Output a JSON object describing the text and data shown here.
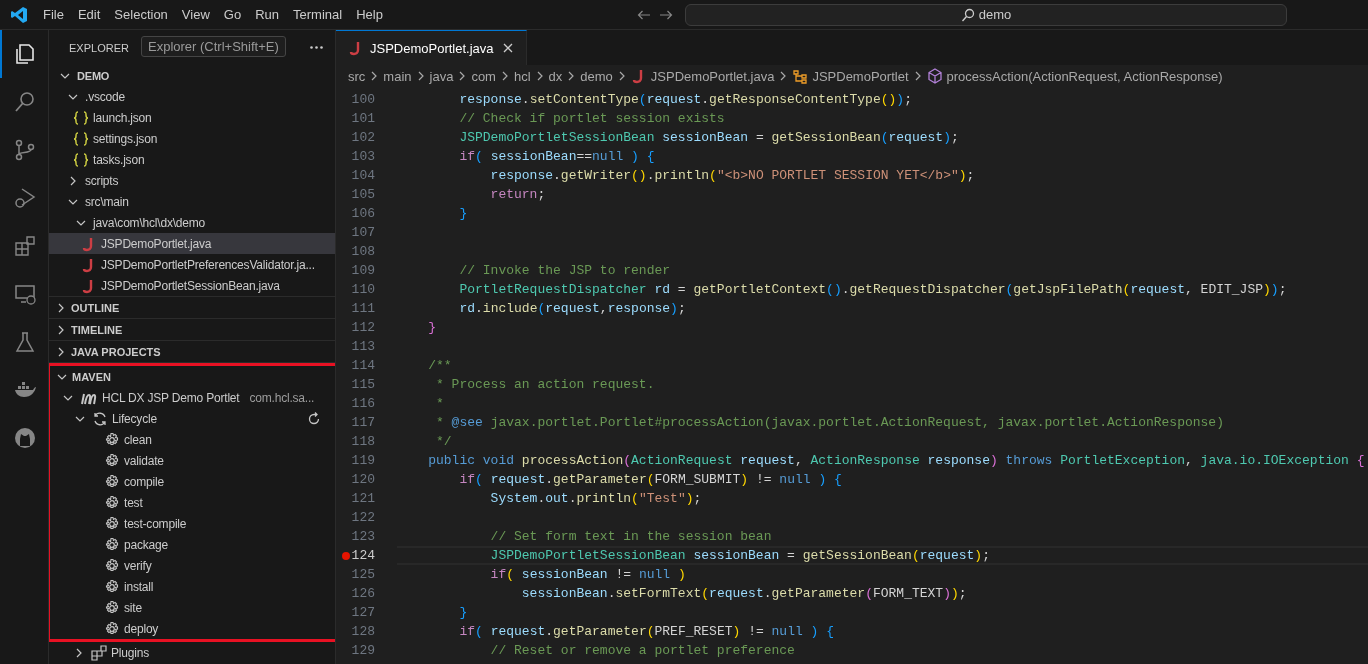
{
  "title_bar": {
    "menus": [
      "File",
      "Edit",
      "Selection",
      "View",
      "Go",
      "Run",
      "Terminal",
      "Help"
    ],
    "command_center": "demo"
  },
  "activity_bar": {
    "items": [
      {
        "selected": true
      },
      {
        "selected": false
      },
      {
        "selected": false
      },
      {
        "selected": false
      },
      {
        "selected": false
      },
      {
        "selected": false
      },
      {
        "selected": false
      },
      {
        "selected": false
      },
      {
        "selected": false
      }
    ]
  },
  "explorer": {
    "title": "EXPLORER",
    "tooltip": "Explorer (Ctrl+Shift+E)",
    "tree": [
      {
        "label": "DEMO",
        "kind": "root",
        "expanded": true,
        "children": [
          {
            "label": ".vscode",
            "kind": "folder",
            "expanded": true,
            "children": [
              {
                "label": "launch.json",
                "kind": "json",
                "selected": false
              },
              {
                "label": "settings.json",
                "kind": "json",
                "selected": false
              },
              {
                "label": "tasks.json",
                "kind": "json",
                "selected": false
              }
            ]
          },
          {
            "label": "scripts",
            "kind": "folder",
            "expanded": false
          },
          {
            "label": "src\\main",
            "kind": "folder",
            "expanded": true,
            "children": [
              {
                "label": "java\\com\\hcl\\dx\\demo",
                "kind": "folder",
                "expanded": true,
                "children": [
                  {
                    "label": "JSPDemoPortlet.java",
                    "kind": "java",
                    "selected": true
                  },
                  {
                    "label": "JSPDemoPortletPreferencesValidator.ja...",
                    "kind": "java",
                    "selected": false
                  },
                  {
                    "label": "JSPDemoPortletSessionBean.java",
                    "kind": "java",
                    "selected": false
                  }
                ]
              }
            ]
          }
        ]
      }
    ]
  },
  "sections": [
    {
      "title": "OUTLINE",
      "expanded": false,
      "highlighted": false
    },
    {
      "title": "TIMELINE",
      "expanded": false,
      "highlighted": false
    },
    {
      "title": "JAVA PROJECTS",
      "expanded": false,
      "highlighted": false
    },
    {
      "title": "MAVEN",
      "expanded": true,
      "highlighted": true,
      "tree": [
        {
          "label": "HCL DX JSP Demo Portlet",
          "description": "com.hcl.sa...",
          "kind": "project",
          "expanded": true,
          "children": [
            {
              "label": "Lifecycle",
              "kind": "lifecycle",
              "expanded": true,
              "children": [
                {
                  "label": "clean",
                  "kind": "goal"
                },
                {
                  "label": "validate",
                  "kind": "goal"
                },
                {
                  "label": "compile",
                  "kind": "goal"
                },
                {
                  "label": "test",
                  "kind": "goal"
                },
                {
                  "label": "test-compile",
                  "kind": "goal"
                },
                {
                  "label": "package",
                  "kind": "goal"
                },
                {
                  "label": "verify",
                  "kind": "goal"
                },
                {
                  "label": "install",
                  "kind": "goal"
                },
                {
                  "label": "site",
                  "kind": "goal"
                },
                {
                  "label": "deploy",
                  "kind": "goal"
                }
              ]
            },
            {
              "label": "Plugins",
              "kind": "plugins",
              "expanded": false
            }
          ]
        }
      ]
    }
  ],
  "editor": {
    "tabs": [
      {
        "label": "JSPDemoPortlet.java",
        "selected": true
      }
    ],
    "breadcrumb": [
      {
        "label": "src",
        "kind": "folder"
      },
      {
        "label": "main",
        "kind": "folder"
      },
      {
        "label": "java",
        "kind": "folder"
      },
      {
        "label": "com",
        "kind": "folder"
      },
      {
        "label": "hcl",
        "kind": "folder"
      },
      {
        "label": "dx",
        "kind": "folder"
      },
      {
        "label": "demo",
        "kind": "folder"
      },
      {
        "label": "JSPDemoPortlet.java",
        "kind": "java"
      },
      {
        "label": "JSPDemoPortlet",
        "kind": "class"
      },
      {
        "label": "processAction(ActionRequest, ActionResponse)",
        "kind": "method"
      }
    ],
    "lines": [
      {
        "number": "100",
        "active": false,
        "breakpoint": false,
        "tokens": [
          {
            "text": "        response",
            "kind": "var"
          },
          {
            "text": ".",
            "kind": "pl"
          },
          {
            "text": "setContentType",
            "kind": "fn"
          },
          {
            "text": "(",
            "kind": "b3"
          },
          {
            "text": "request",
            "kind": "var"
          },
          {
            "text": ".",
            "kind": "pl"
          },
          {
            "text": "getResponseContentType",
            "kind": "fn"
          },
          {
            "text": "()",
            "kind": "b1"
          },
          {
            "text": ")",
            "kind": "b3"
          },
          {
            "text": ";",
            "kind": "pl"
          }
        ]
      },
      {
        "number": "101",
        "active": false,
        "breakpoint": false,
        "tokens": [
          {
            "text": "        // Check if portlet session exists",
            "kind": "com"
          }
        ]
      },
      {
        "number": "102",
        "active": false,
        "breakpoint": false,
        "tokens": [
          {
            "text": "        JSPDemoPortletSessionBean",
            "kind": "type"
          },
          {
            "text": " sessionBean",
            "kind": "var"
          },
          {
            "text": " = ",
            "kind": "pl"
          },
          {
            "text": "getSessionBean",
            "kind": "fn"
          },
          {
            "text": "(",
            "kind": "b3"
          },
          {
            "text": "request",
            "kind": "var"
          },
          {
            "text": ")",
            "kind": "b3"
          },
          {
            "text": ";",
            "kind": "pl"
          }
        ]
      },
      {
        "number": "103",
        "active": false,
        "breakpoint": false,
        "tokens": [
          {
            "text": "        if",
            "kind": "ctl"
          },
          {
            "text": "(",
            "kind": "b3"
          },
          {
            "text": " sessionBean",
            "kind": "var"
          },
          {
            "text": "==",
            "kind": "pl"
          },
          {
            "text": "null",
            "kind": "kw"
          },
          {
            "text": " )",
            "kind": "b3"
          },
          {
            "text": " {",
            "kind": "b3"
          }
        ]
      },
      {
        "number": "104",
        "active": false,
        "breakpoint": false,
        "tokens": [
          {
            "text": "            response",
            "kind": "var"
          },
          {
            "text": ".",
            "kind": "pl"
          },
          {
            "text": "getWriter",
            "kind": "fn"
          },
          {
            "text": "()",
            "kind": "b1"
          },
          {
            "text": ".",
            "kind": "pl"
          },
          {
            "text": "println",
            "kind": "fn"
          },
          {
            "text": "(",
            "kind": "b1"
          },
          {
            "text": "\"<b>NO PORTLET SESSION YET</b>\"",
            "kind": "str"
          },
          {
            "text": ")",
            "kind": "b1"
          },
          {
            "text": ";",
            "kind": "pl"
          }
        ]
      },
      {
        "number": "105",
        "active": false,
        "breakpoint": false,
        "tokens": [
          {
            "text": "            return",
            "kind": "ctl"
          },
          {
            "text": ";",
            "kind": "pl"
          }
        ]
      },
      {
        "number": "106",
        "active": false,
        "breakpoint": false,
        "tokens": [
          {
            "text": "        }",
            "kind": "b3"
          }
        ]
      },
      {
        "number": "107",
        "active": false,
        "breakpoint": false
      },
      {
        "number": "108",
        "active": false,
        "breakpoint": false
      },
      {
        "number": "109",
        "active": false,
        "breakpoint": false,
        "tokens": [
          {
            "text": "        // Invoke the JSP to render",
            "kind": "com"
          }
        ]
      },
      {
        "number": "110",
        "active": false,
        "breakpoint": false,
        "tokens": [
          {
            "text": "        PortletRequestDispatcher",
            "kind": "type"
          },
          {
            "text": " rd",
            "kind": "var"
          },
          {
            "text": " = ",
            "kind": "pl"
          },
          {
            "text": "getPortletContext",
            "kind": "fn"
          },
          {
            "text": "()",
            "kind": "b3"
          },
          {
            "text": ".",
            "kind": "pl"
          },
          {
            "text": "getRequestDispatcher",
            "kind": "fn"
          },
          {
            "text": "(",
            "kind": "b3"
          },
          {
            "text": "getJspFilePath",
            "kind": "fn"
          },
          {
            "text": "(",
            "kind": "b1"
          },
          {
            "text": "request",
            "kind": "var"
          },
          {
            "text": ", EDIT_JSP",
            "kind": "pl"
          },
          {
            "text": ")",
            "kind": "b1"
          },
          {
            "text": ")",
            "kind": "b3"
          },
          {
            "text": ";",
            "kind": "pl"
          }
        ]
      },
      {
        "number": "111",
        "active": false,
        "breakpoint": false,
        "tokens": [
          {
            "text": "        rd",
            "kind": "var"
          },
          {
            "text": ".",
            "kind": "pl"
          },
          {
            "text": "include",
            "kind": "fn"
          },
          {
            "text": "(",
            "kind": "b3"
          },
          {
            "text": "request",
            "kind": "var"
          },
          {
            "text": ",",
            "kind": "pl"
          },
          {
            "text": "response",
            "kind": "var"
          },
          {
            "text": ")",
            "kind": "b3"
          },
          {
            "text": ";",
            "kind": "pl"
          }
        ]
      },
      {
        "number": "112",
        "active": false,
        "breakpoint": false,
        "tokens": [
          {
            "text": "    }",
            "kind": "b2"
          }
        ]
      },
      {
        "number": "113",
        "active": false,
        "breakpoint": false
      },
      {
        "number": "114",
        "active": false,
        "breakpoint": false,
        "tokens": [
          {
            "text": "    /**",
            "kind": "com"
          }
        ]
      },
      {
        "number": "115",
        "active": false,
        "breakpoint": false,
        "tokens": [
          {
            "text": "     * Process an action request.",
            "kind": "com"
          }
        ]
      },
      {
        "number": "116",
        "active": false,
        "breakpoint": false,
        "tokens": [
          {
            "text": "     *",
            "kind": "com"
          }
        ]
      },
      {
        "number": "117",
        "active": false,
        "breakpoint": false,
        "tokens": [
          {
            "text": "     * ",
            "kind": "com"
          },
          {
            "text": "@see",
            "kind": "kw"
          },
          {
            "text": " javax.portlet.Portlet#processAction(javax.portlet.ActionRequest, javax.portlet.ActionResponse)",
            "kind": "com"
          }
        ]
      },
      {
        "number": "118",
        "active": false,
        "breakpoint": false,
        "tokens": [
          {
            "text": "     */",
            "kind": "com"
          }
        ]
      },
      {
        "number": "119",
        "active": false,
        "breakpoint": false,
        "tokens": [
          {
            "text": "    public void",
            "kind": "kw"
          },
          {
            "text": " processAction",
            "kind": "fn"
          },
          {
            "text": "(",
            "kind": "b2"
          },
          {
            "text": "ActionRequest",
            "kind": "type"
          },
          {
            "text": " request",
            "kind": "var"
          },
          {
            "text": ", ",
            "kind": "pl"
          },
          {
            "text": "ActionResponse",
            "kind": "type"
          },
          {
            "text": " response",
            "kind": "var"
          },
          {
            "text": ")",
            "kind": "b2"
          },
          {
            "text": " throws",
            "kind": "kw"
          },
          {
            "text": " PortletException",
            "kind": "type"
          },
          {
            "text": ", ",
            "kind": "pl"
          },
          {
            "text": "java.io.IOException",
            "kind": "type"
          },
          {
            "text": " {",
            "kind": "b2"
          }
        ]
      },
      {
        "number": "120",
        "active": false,
        "breakpoint": false,
        "tokens": [
          {
            "text": "        if",
            "kind": "ctl"
          },
          {
            "text": "(",
            "kind": "b3"
          },
          {
            "text": " request",
            "kind": "var"
          },
          {
            "text": ".",
            "kind": "pl"
          },
          {
            "text": "getParameter",
            "kind": "fn"
          },
          {
            "text": "(",
            "kind": "b1"
          },
          {
            "text": "FORM_SUBMIT",
            "kind": "pl"
          },
          {
            "text": ")",
            "kind": "b1"
          },
          {
            "text": " != ",
            "kind": "pl"
          },
          {
            "text": "null",
            "kind": "kw"
          },
          {
            "text": " )",
            "kind": "b3"
          },
          {
            "text": " {",
            "kind": "b3"
          }
        ]
      },
      {
        "number": "121",
        "active": false,
        "breakpoint": false,
        "tokens": [
          {
            "text": "            System",
            "kind": "var"
          },
          {
            "text": ".",
            "kind": "pl"
          },
          {
            "text": "out",
            "kind": "var"
          },
          {
            "text": ".",
            "kind": "pl"
          },
          {
            "text": "println",
            "kind": "fn"
          },
          {
            "text": "(",
            "kind": "b1"
          },
          {
            "text": "\"Test\"",
            "kind": "str"
          },
          {
            "text": ")",
            "kind": "b1"
          },
          {
            "text": ";",
            "kind": "pl"
          }
        ]
      },
      {
        "number": "122",
        "active": false,
        "breakpoint": false
      },
      {
        "number": "123",
        "active": false,
        "breakpoint": false,
        "tokens": [
          {
            "text": "            // Set form text in the session bean",
            "kind": "com"
          }
        ]
      },
      {
        "number": "124",
        "active": true,
        "breakpoint": true,
        "tokens": [
          {
            "text": "            JSPDemoPortletSessionBean",
            "kind": "type"
          },
          {
            "text": " sessionBean",
            "kind": "var"
          },
          {
            "text": " = ",
            "kind": "pl"
          },
          {
            "text": "getSessionBean",
            "kind": "fn"
          },
          {
            "text": "(",
            "kind": "b1"
          },
          {
            "text": "request",
            "kind": "var"
          },
          {
            "text": ")",
            "kind": "b1"
          },
          {
            "text": ";",
            "kind": "pl"
          }
        ]
      },
      {
        "number": "125",
        "active": false,
        "breakpoint": false,
        "tokens": [
          {
            "text": "            if",
            "kind": "ctl"
          },
          {
            "text": "(",
            "kind": "b1"
          },
          {
            "text": " sessionBean",
            "kind": "var"
          },
          {
            "text": " != ",
            "kind": "pl"
          },
          {
            "text": "null",
            "kind": "kw"
          },
          {
            "text": " )",
            "kind": "b1"
          }
        ]
      },
      {
        "number": "126",
        "active": false,
        "breakpoint": false,
        "tokens": [
          {
            "text": "                sessionBean",
            "kind": "var"
          },
          {
            "text": ".",
            "kind": "pl"
          },
          {
            "text": "setFormText",
            "kind": "fn"
          },
          {
            "text": "(",
            "kind": "b1"
          },
          {
            "text": "request",
            "kind": "var"
          },
          {
            "text": ".",
            "kind": "pl"
          },
          {
            "text": "getParameter",
            "kind": "fn"
          },
          {
            "text": "(",
            "kind": "b2"
          },
          {
            "text": "FORM_TEXT",
            "kind": "pl"
          },
          {
            "text": ")",
            "kind": "b2"
          },
          {
            "text": ")",
            "kind": "b1"
          },
          {
            "text": ";",
            "kind": "pl"
          }
        ]
      },
      {
        "number": "127",
        "active": false,
        "breakpoint": false,
        "tokens": [
          {
            "text": "        }",
            "kind": "b3"
          }
        ]
      },
      {
        "number": "128",
        "active": false,
        "breakpoint": false,
        "tokens": [
          {
            "text": "        if",
            "kind": "ctl"
          },
          {
            "text": "(",
            "kind": "b3"
          },
          {
            "text": " request",
            "kind": "var"
          },
          {
            "text": ".",
            "kind": "pl"
          },
          {
            "text": "getParameter",
            "kind": "fn"
          },
          {
            "text": "(",
            "kind": "b1"
          },
          {
            "text": "PREF_RESET",
            "kind": "pl"
          },
          {
            "text": ")",
            "kind": "b1"
          },
          {
            "text": " != ",
            "kind": "pl"
          },
          {
            "text": "null",
            "kind": "kw"
          },
          {
            "text": " )",
            "kind": "b3"
          },
          {
            "text": " {",
            "kind": "b3"
          }
        ]
      },
      {
        "number": "129",
        "active": false,
        "breakpoint": false,
        "tokens": [
          {
            "text": "            // Reset or remove a portlet preference",
            "kind": "com"
          }
        ]
      }
    ]
  }
}
